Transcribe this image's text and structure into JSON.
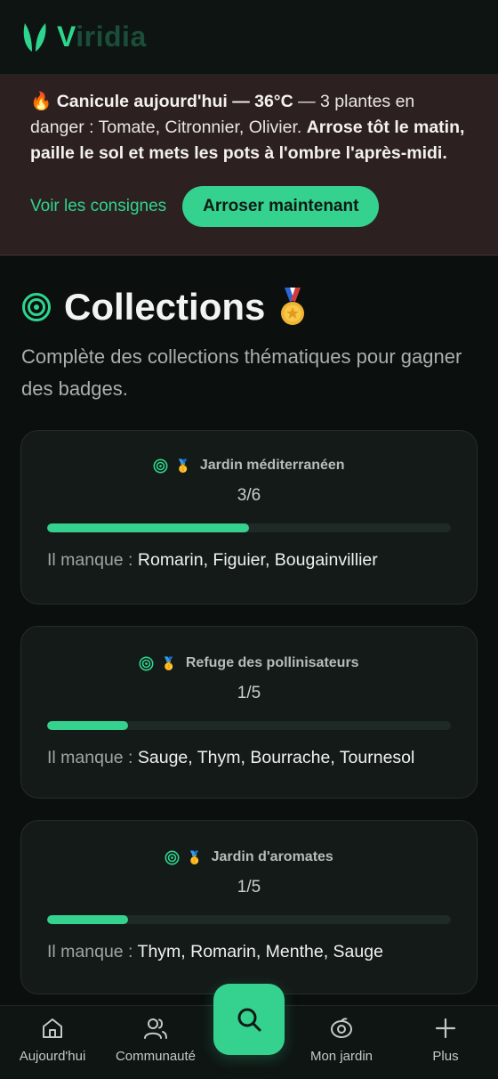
{
  "app": {
    "name_first": "V",
    "name_rest": "iridia"
  },
  "alert": {
    "icon": "🔥",
    "headline": "Canicule aujourd'hui — 36°C",
    "body": " — 3 plantes en danger : Tomate, Citronnier, Olivier. ",
    "advice": "Arrose tôt le matin, paille le sol et mets les pots à l'ombre l'après-midi.",
    "link_label": "Voir les consignes",
    "button_label": "Arroser maintenant"
  },
  "section": {
    "title": "Collections",
    "medal": "🏅",
    "subtitle": "Complète des collections thématiques pour gagner des badges."
  },
  "collections": [
    {
      "medal": "🥇",
      "name": "Jardin méditerranéen",
      "count": "3/6",
      "progress": 0.5,
      "missing_label": "Il manque : ",
      "missing": "Romarin, Figuier, Bougainvillier"
    },
    {
      "medal": "🥇",
      "name": "Refuge des pollinisateurs",
      "count": "1/5",
      "progress": 0.2,
      "missing_label": "Il manque : ",
      "missing": "Sauge, Thym, Bourrache, Tournesol"
    },
    {
      "medal": "🥇",
      "name": "Jardin d'aromates",
      "count": "1/5",
      "progress": 0.2,
      "missing_label": "Il manque : ",
      "missing": "Thym, Romarin, Menthe, Sauge"
    }
  ],
  "nav": {
    "today": "Aujourd'hui",
    "community": "Communauté",
    "search_icon": "search-icon",
    "garden": "Mon jardin",
    "more": "Plus"
  },
  "colors": {
    "accent": "#35d18f",
    "alert_bg": "#2c2120",
    "card_bg": "#141a18"
  }
}
